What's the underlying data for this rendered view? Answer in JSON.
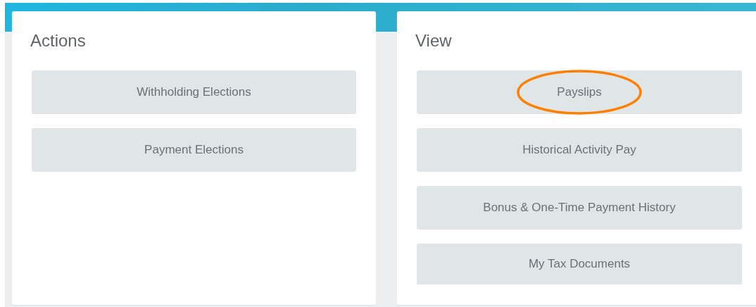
{
  "panels": [
    {
      "title": "Actions",
      "items": [
        {
          "label": "Withholding Elections",
          "circled": false
        },
        {
          "label": "Payment Elections",
          "circled": false
        }
      ]
    },
    {
      "title": "View",
      "items": [
        {
          "label": "Payslips",
          "circled": true
        },
        {
          "label": "Historical Activity Pay",
          "circled": false
        },
        {
          "label": "Bonus & One-Time Payment History",
          "circled": false
        },
        {
          "label": "My Tax Documents",
          "circled": false
        }
      ]
    }
  ]
}
